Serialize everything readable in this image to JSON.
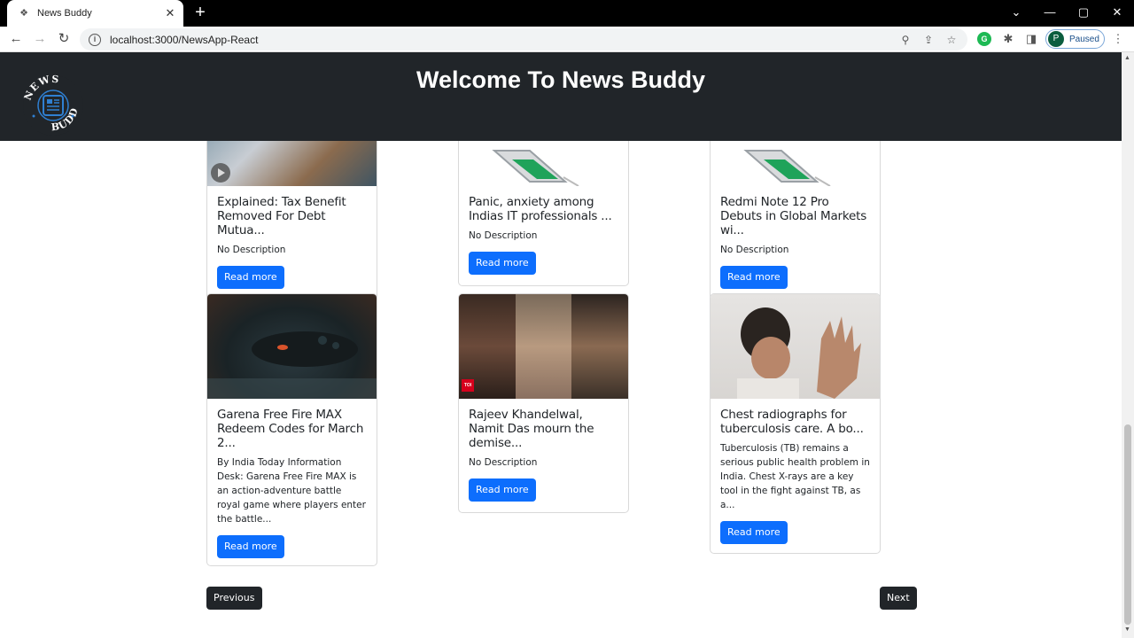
{
  "browser": {
    "tab_title": "News Buddy",
    "url": "localhost:3000/NewsApp-React",
    "profile_initial": "P",
    "profile_status": "Paused"
  },
  "header": {
    "title": "Welcome To News Buddy",
    "logo_text": "NEWS BUDDY"
  },
  "cards": [
    {
      "title": "Explained: Tax Benefit Removed For Debt Mutua...",
      "description": "No Description",
      "button": "Read more"
    },
    {
      "title": "Panic, anxiety among Indias IT professionals ...",
      "description": "No Description",
      "button": "Read more"
    },
    {
      "title": "Redmi Note 12 Pro Debuts in Global Markets wi...",
      "description": "No Description",
      "button": "Read more"
    },
    {
      "title": "Garena Free Fire MAX Redeem Codes for March 2...",
      "description": "By India Today Information Desk: Garena Free Fire MAX is an action-adventure battle royal game where players enter the battle...",
      "button": "Read more"
    },
    {
      "title": "Rajeev Khandelwal, Namit Das mourn the demise...",
      "description": "No Description",
      "button": "Read more",
      "badge": "TOI"
    },
    {
      "title": "Chest radiographs for tuberculosis care. A bo...",
      "description": "Tuberculosis (TB) remains a serious public health problem in India. Chest X-rays are a key tool in the fight against TB, as a...",
      "button": "Read more"
    }
  ],
  "pagination": {
    "previous": "Previous",
    "next": "Next"
  }
}
